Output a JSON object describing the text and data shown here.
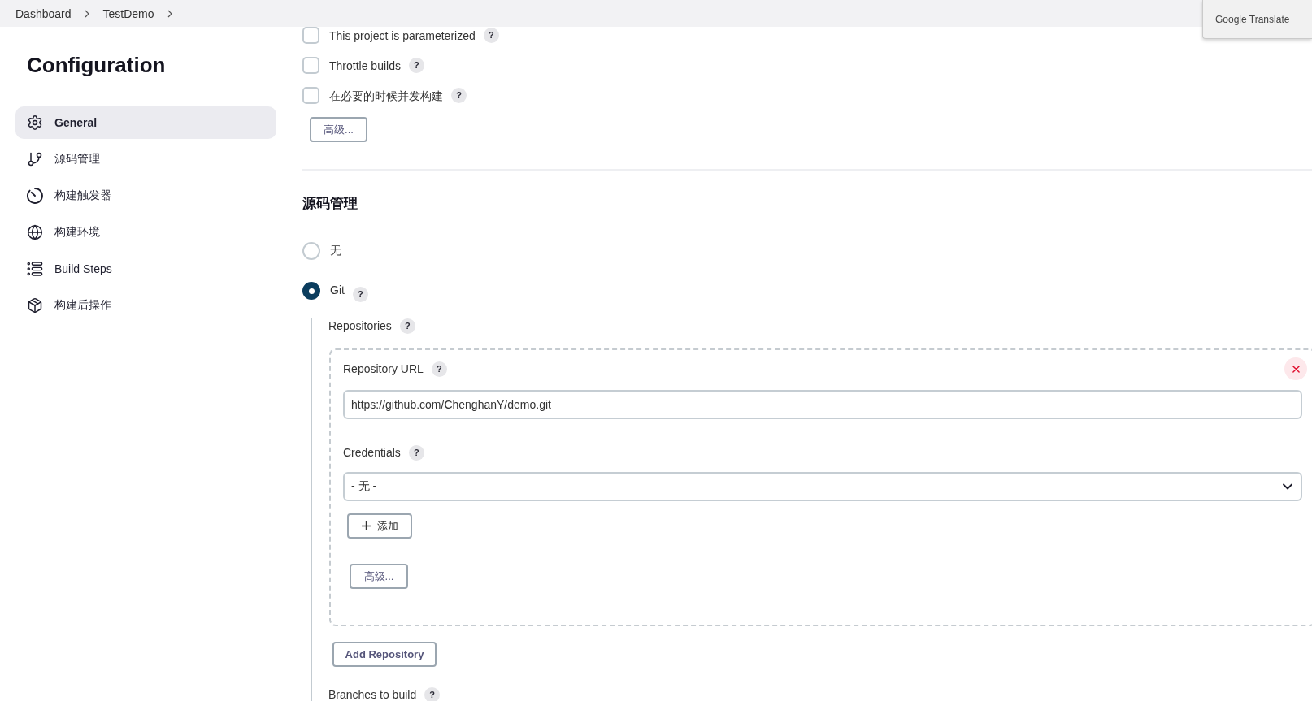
{
  "breadcrumbs": [
    {
      "label": "Dashboard"
    },
    {
      "label": "TestDemo"
    }
  ],
  "translate_popup": {
    "label": "Google Translate"
  },
  "sidebar": {
    "title": "Configuration",
    "items": [
      {
        "label": "General",
        "selected": true
      },
      {
        "label": "源码管理",
        "selected": false
      },
      {
        "label": "构建触发器",
        "selected": false
      },
      {
        "label": "构建环境",
        "selected": false
      },
      {
        "label": "Build Steps",
        "selected": false
      },
      {
        "label": "构建后操作",
        "selected": false
      }
    ]
  },
  "general": {
    "options": [
      {
        "label": "This project is parameterized",
        "checked": false,
        "help": "?"
      },
      {
        "label": "Throttle builds",
        "checked": false,
        "help": "?"
      },
      {
        "label": "在必要的时候并发构建",
        "checked": false,
        "help": "?"
      }
    ],
    "advanced_button": "高级..."
  },
  "source_control": {
    "heading": "源码管理",
    "options": [
      {
        "label": "无",
        "selected": false
      },
      {
        "label": "Git",
        "selected": true,
        "help": "?"
      }
    ],
    "git": {
      "repositories": {
        "label": "Repositories",
        "help": "?"
      },
      "repository": {
        "url": {
          "label": "Repository URL",
          "help": "?",
          "value": "https://github.com/ChenghanY/demo.git"
        },
        "credentials": {
          "label": "Credentials",
          "help": "?",
          "value": "- 无 -"
        },
        "add_button": "添加",
        "advanced_button": "高级..."
      },
      "add_repository_button": "Add Repository",
      "branches": {
        "label": "Branches to build",
        "help": "?"
      }
    }
  }
}
